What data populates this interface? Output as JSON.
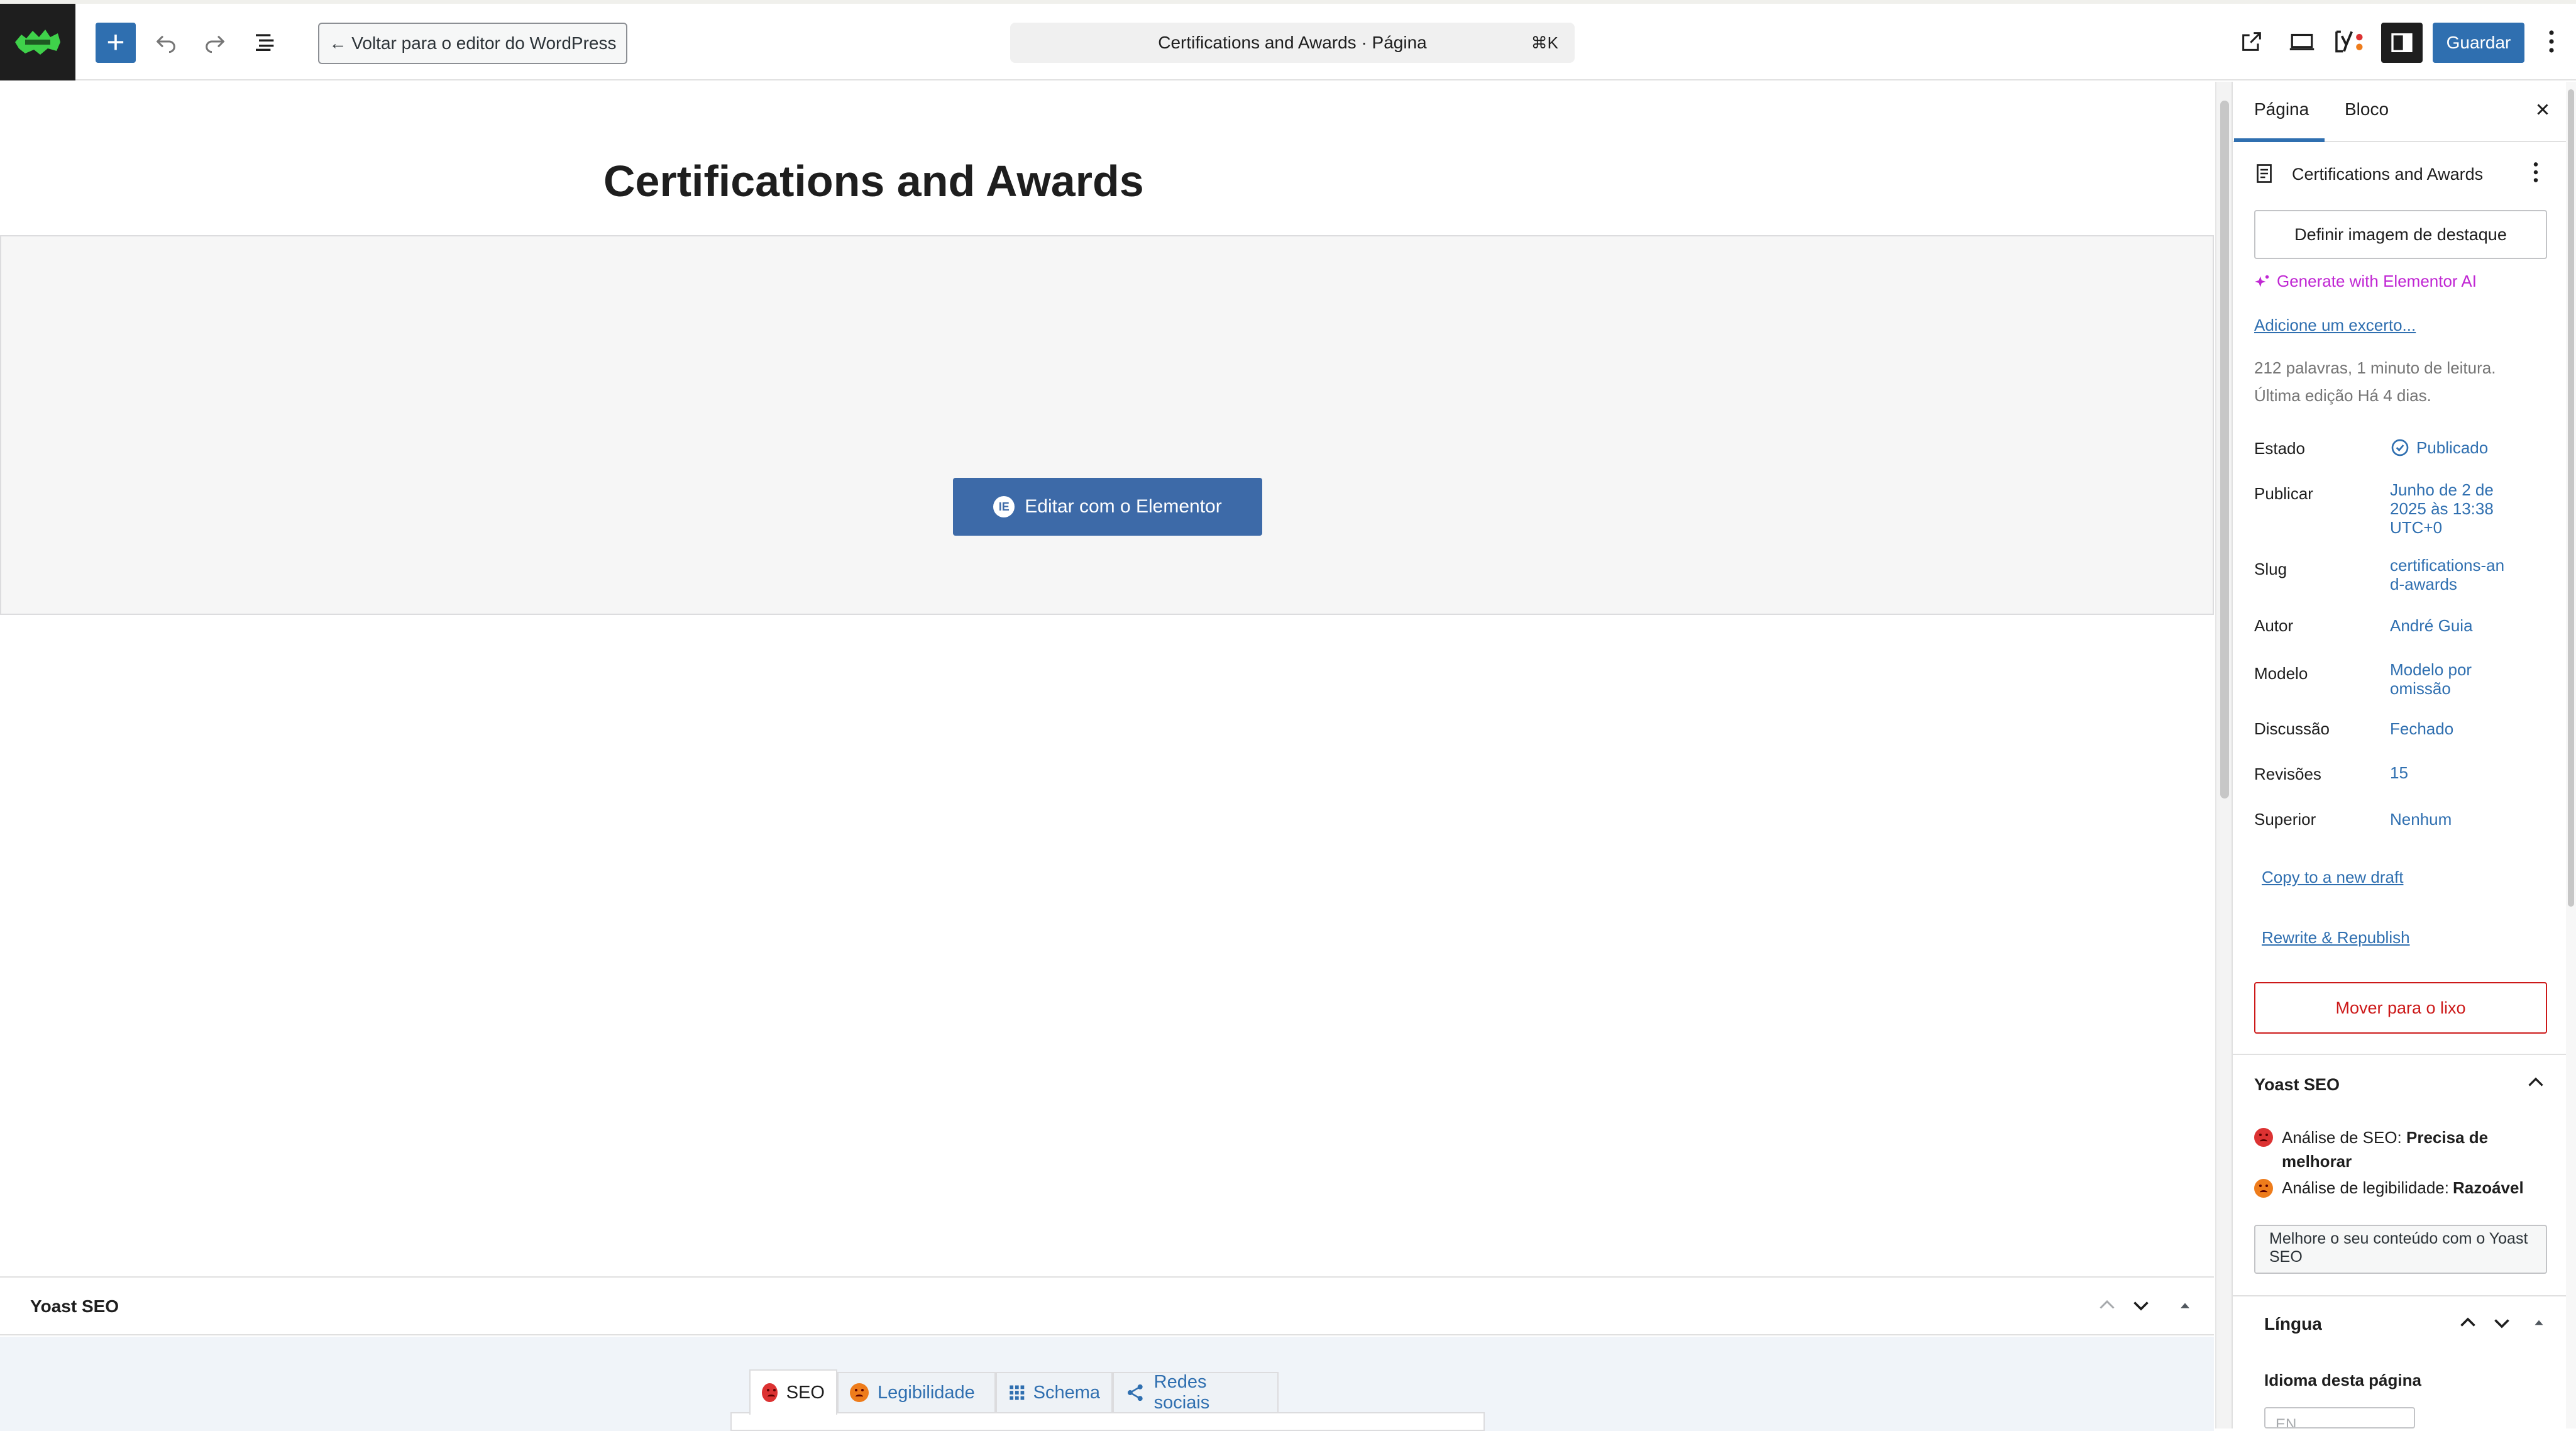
{
  "topbar": {
    "back_label": "← Voltar para o editor do WordPress",
    "doc_title": "Certifications and Awards · Página",
    "doc_shortcut": "⌘K",
    "save_label": "Guardar"
  },
  "page": {
    "title": "Certifications and Awards",
    "edit_elementor_label": "Editar com o Elementor"
  },
  "yoast_meta": {
    "title": "Yoast SEO",
    "tabs": [
      {
        "label": "SEO"
      },
      {
        "label": "Legibilidade"
      },
      {
        "label": "Schema"
      },
      {
        "label": "Redes sociais"
      }
    ]
  },
  "sidebar": {
    "tab_page": "Página",
    "tab_block": "Bloco",
    "doc_name": "Certifications and Awards",
    "featured_image": "Definir imagem de destaque",
    "elementor_ai": "Generate with Elementor AI",
    "excerpt_link": "Adicione um excerto...",
    "stats_line1": "212 palavras, 1 minuto de leitura.",
    "stats_line2": "Última edição Há 4 dias.",
    "fields": [
      {
        "label": "Estado",
        "value": "Publicado"
      },
      {
        "label": "Publicar",
        "value": "Junho de 2 de 2025 às 13:38 UTC+0"
      },
      {
        "label": "Slug",
        "value": "certifications-and-awards"
      },
      {
        "label": "Autor",
        "value": "André Guia"
      },
      {
        "label": "Modelo",
        "value": "Modelo por omissão"
      },
      {
        "label": "Discussão",
        "value": "Fechado"
      },
      {
        "label": "Revisões",
        "value": "15"
      },
      {
        "label": "Superior",
        "value": "Nenhum"
      }
    ],
    "copy_draft": "Copy to a new draft",
    "rewrite_republish": "Rewrite & Republish",
    "trash": "Mover para o lixo",
    "yoast": {
      "title": "Yoast SEO",
      "seo_prefix": "Análise de SEO: ",
      "seo_status": "Precisa de melhorar",
      "read_prefix": "Análise de legibilidade: ",
      "read_status": "Razoável",
      "improve_btn": "Melhore o seu conteúdo com o Yoast SEO"
    },
    "language": {
      "title": "Língua",
      "subtitle": "Idioma desta página",
      "select_value": "EN"
    }
  },
  "colors": {
    "accent": "#2f6fb0",
    "elementor": "#3d6aa8",
    "danger": "#cc1818",
    "elementor_ai": "#c026d3"
  }
}
